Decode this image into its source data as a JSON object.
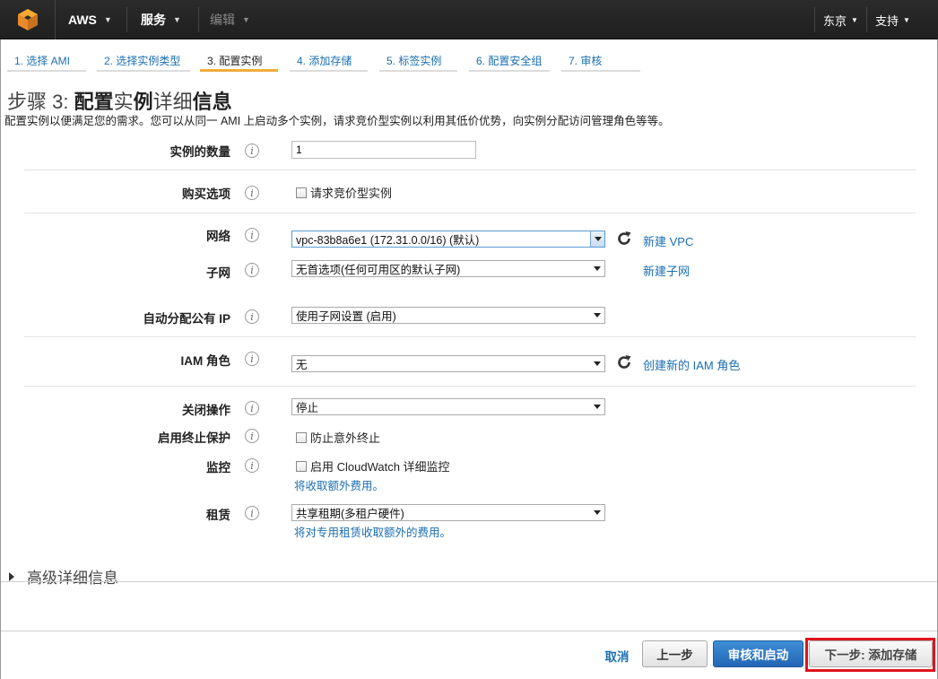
{
  "nav": {
    "brand": "AWS",
    "services": "服务",
    "edit": "编辑",
    "region": "东京",
    "support": "支持"
  },
  "steps": [
    {
      "label": "1. 选择 AMI"
    },
    {
      "label": "2. 选择实例类型"
    },
    {
      "label": "3. 配置实例"
    },
    {
      "label": "4. 添加存储"
    },
    {
      "label": "5. 标签实例"
    },
    {
      "label": "6. 配置安全组"
    },
    {
      "label": "7. 审核"
    }
  ],
  "page": {
    "title_prefix": "步骤 3: ",
    "title_bold1": "配置",
    "title_thin1": "实",
    "title_bold2": "例",
    "title_thin2": "详细",
    "title_bold3": "信息",
    "subtitle": "配置实例以便满足您的需求。您可以从同一 AMI 上启动多个实例，请求竞价型实例以利用其低价优势，向实例分配访问管理角色等等。"
  },
  "form": {
    "instance_count_label": "实例的数量",
    "instance_count_value": "1",
    "purchase_label": "购买选项",
    "purchase_checkbox": "请求竞价型实例",
    "network_label": "网络",
    "network_value": "vpc-83b8a6e1 (172.31.0.0/16) (默认)",
    "new_vpc": "新建 VPC",
    "subnet_label": "子网",
    "subnet_value": "无首选项(任何可用区的默认子网)",
    "new_subnet": "新建子网",
    "public_ip_label": "自动分配公有 IP",
    "public_ip_value": "使用子网设置 (启用)",
    "iam_label": "IAM 角色",
    "iam_value": "无",
    "new_iam": "创建新的 IAM 角色",
    "shutdown_label": "关闭操作",
    "shutdown_value": "停止",
    "termination_label": "启用终止保护",
    "termination_checkbox": "防止意外终止",
    "monitoring_label": "监控",
    "monitoring_checkbox": "启用 CloudWatch 详细监控",
    "monitoring_note": "将收取额外费用。",
    "tenancy_label": "租赁",
    "tenancy_value": "共享租期(多租户硬件)",
    "tenancy_note": "将对专用租赁收取额外的费用。",
    "info_glyph": "i"
  },
  "advanced": "高级详细信息",
  "footer": {
    "cancel": "取消",
    "previous": "上一步",
    "review_launch": "审核和启动",
    "next": "下一步: 添加存储"
  },
  "colors": {
    "link": "#1a6fb2",
    "active_step": "#f0ad3a",
    "primary_button": "#2266b5",
    "highlight": "#e0131b"
  }
}
